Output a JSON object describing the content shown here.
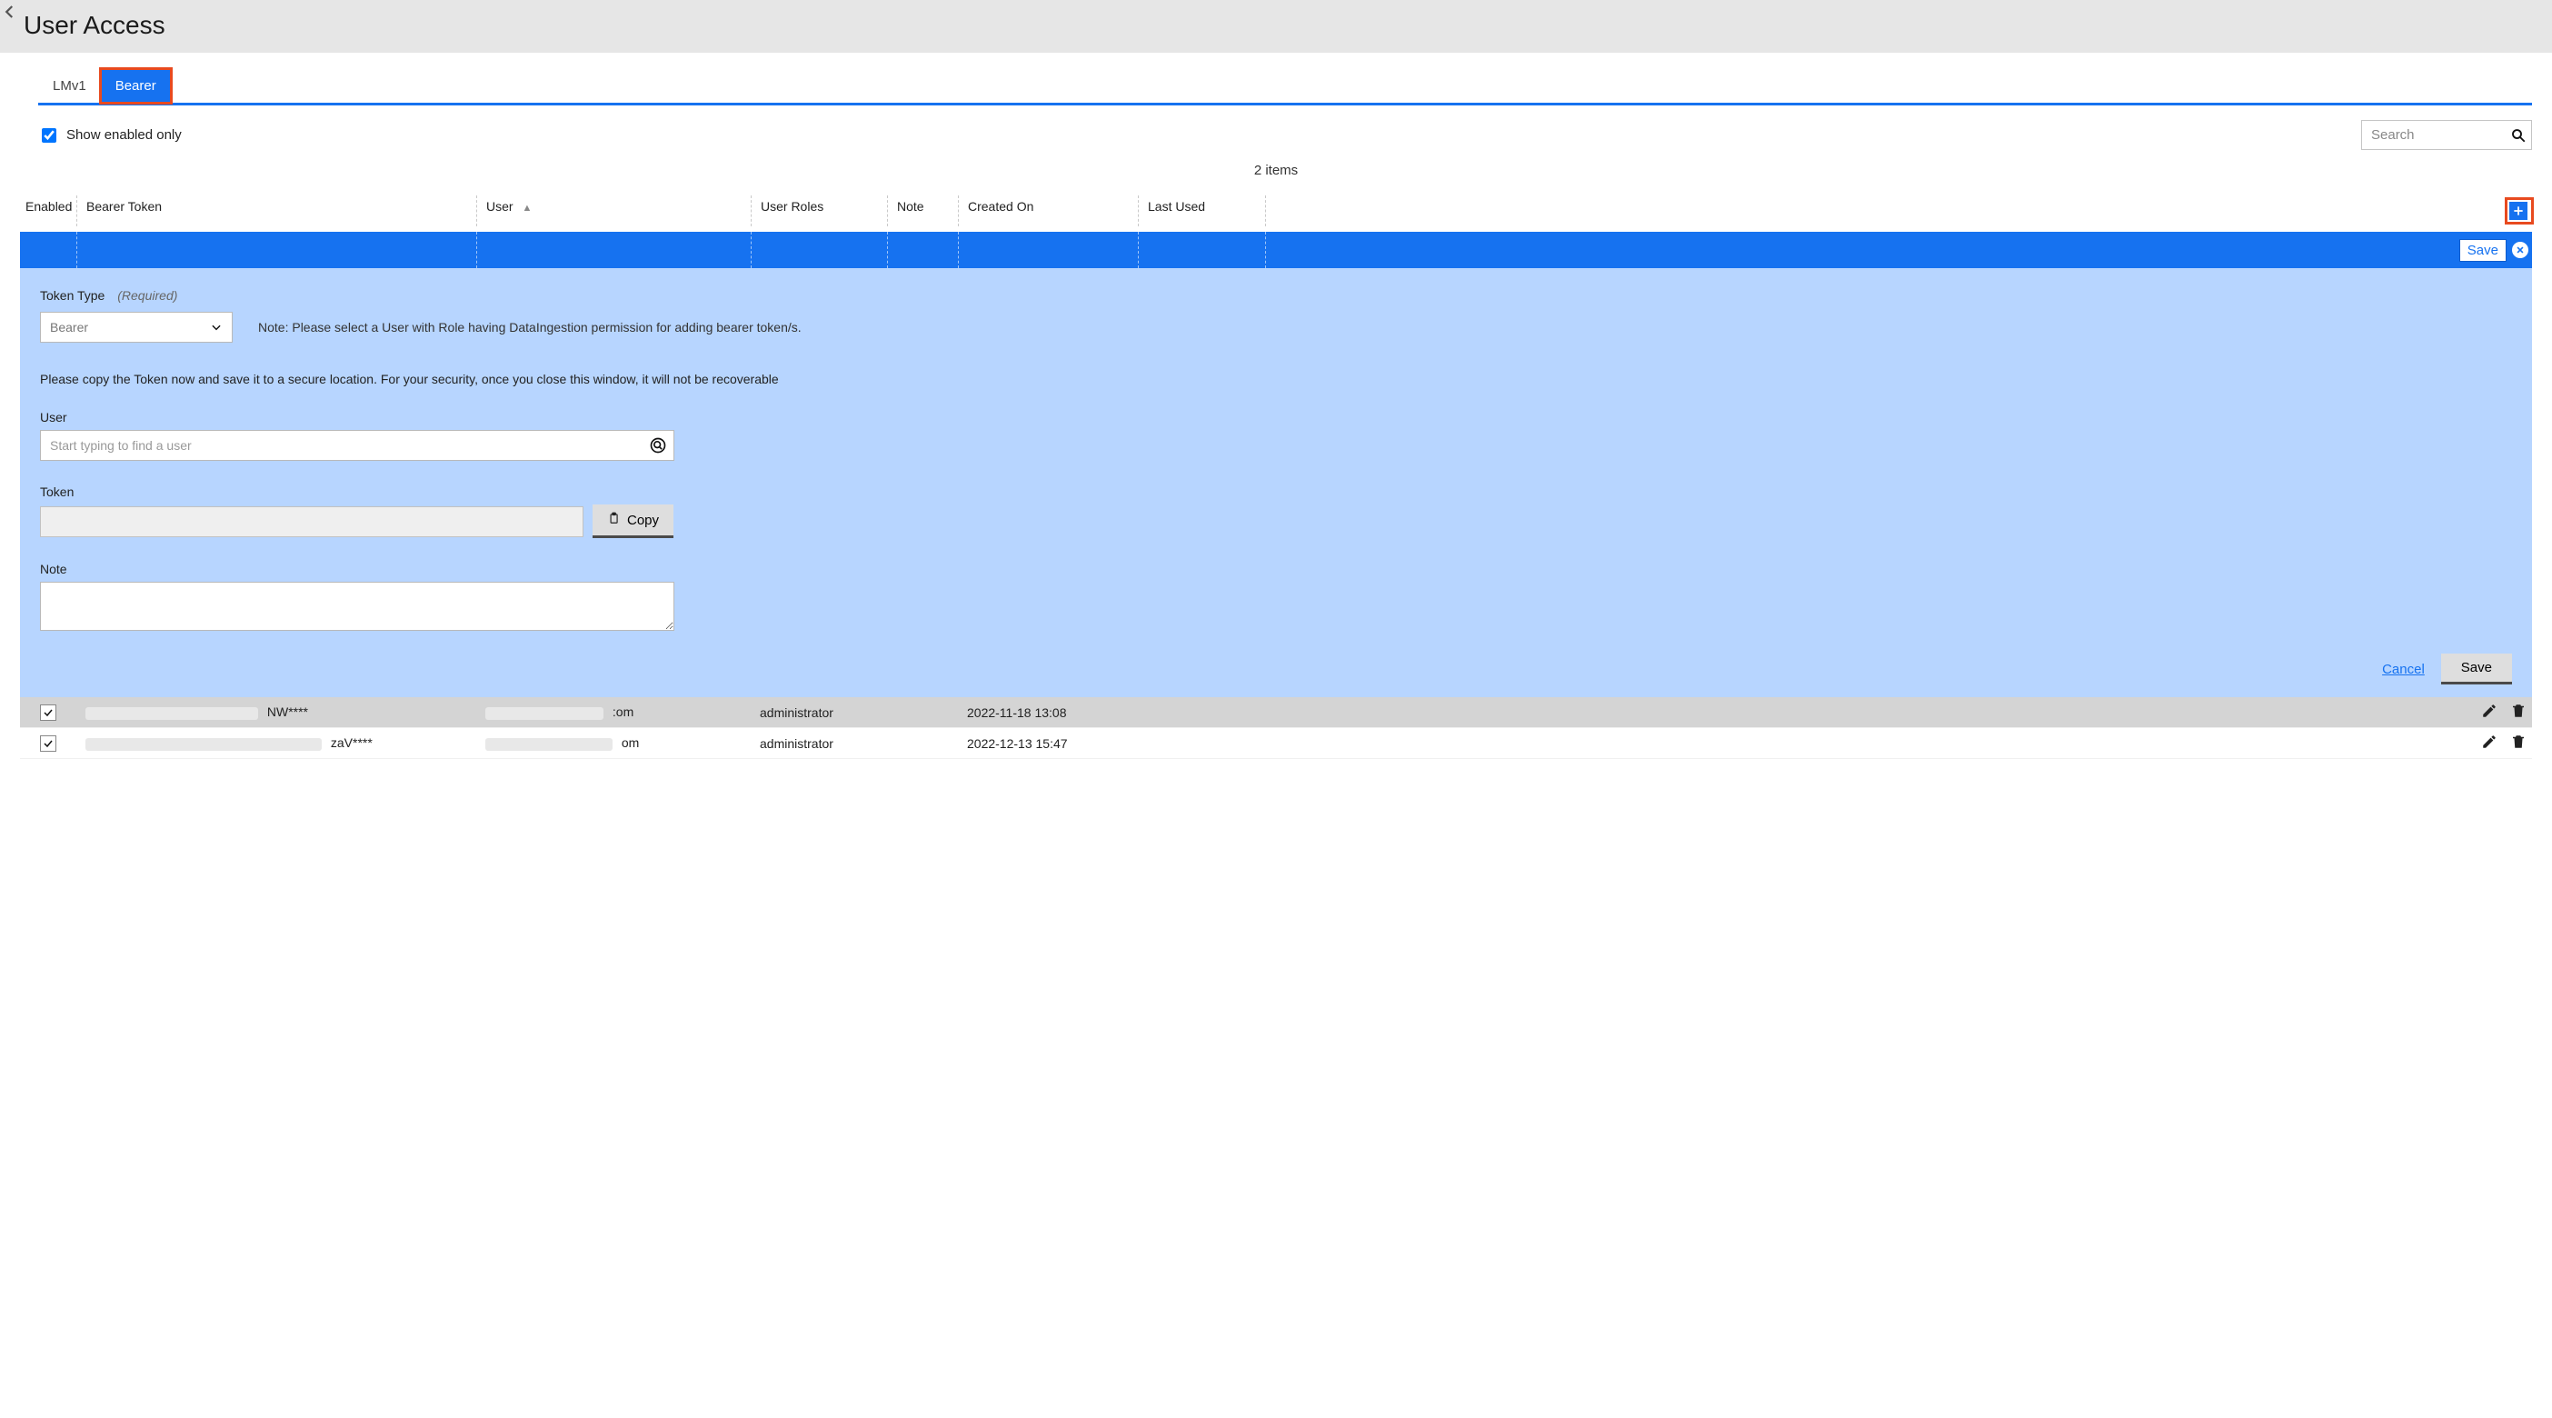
{
  "header": {
    "title": "User Access"
  },
  "tabs": [
    {
      "label": "LMv1",
      "active": false
    },
    {
      "label": "Bearer",
      "active": true
    }
  ],
  "controls": {
    "show_enabled_label": "Show enabled only",
    "show_enabled_checked": true,
    "search_placeholder": "Search"
  },
  "item_count": "2 items",
  "columns": {
    "enabled": "Enabled",
    "token": "Bearer Token",
    "user": "User",
    "roles": "User Roles",
    "note": "Note",
    "created": "Created On",
    "lastused": "Last Used"
  },
  "insert_row": {
    "save_label": "Save"
  },
  "form": {
    "token_type_label": "Token Type",
    "required_label": "(Required)",
    "token_type_value": "Bearer",
    "helper": "Note: Please select a User with Role having DataIngestion permission for adding bearer token/s.",
    "copy_warning": "Please copy the Token now and save it to a secure location. For your security, once you close this window, it will not be recoverable",
    "user_label": "User",
    "user_placeholder": "Start typing to find a user",
    "token_label": "Token",
    "copy_label": "Copy",
    "note_label": "Note",
    "cancel_label": "Cancel",
    "save_label": "Save"
  },
  "rows": [
    {
      "enabled": true,
      "token_suffix": "NW****",
      "user_suffix": ":om",
      "roles": "administrator",
      "note": "",
      "created": "2022-11-18 13:08",
      "lastused": ""
    },
    {
      "enabled": true,
      "token_suffix": "zaV****",
      "user_suffix": "om",
      "roles": "administrator",
      "note": "",
      "created": "2022-12-13 15:47",
      "lastused": ""
    }
  ]
}
